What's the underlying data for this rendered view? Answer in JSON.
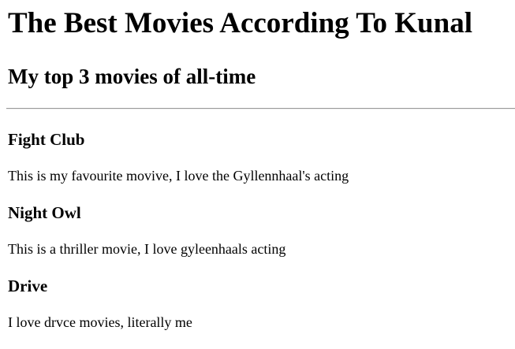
{
  "page": {
    "title": "The Best Movies According To Kunal",
    "subtitle": "My top 3 movies of all-time"
  },
  "movies": [
    {
      "title": "Fight Club",
      "description": "This is my favourite movive, I love the Gyllennhaal's acting"
    },
    {
      "title": "Night Owl",
      "description": "This is a thriller movie, I love gyleenhaals acting"
    },
    {
      "title": "Drive",
      "description": "I love drvce movies, literally me"
    }
  ]
}
